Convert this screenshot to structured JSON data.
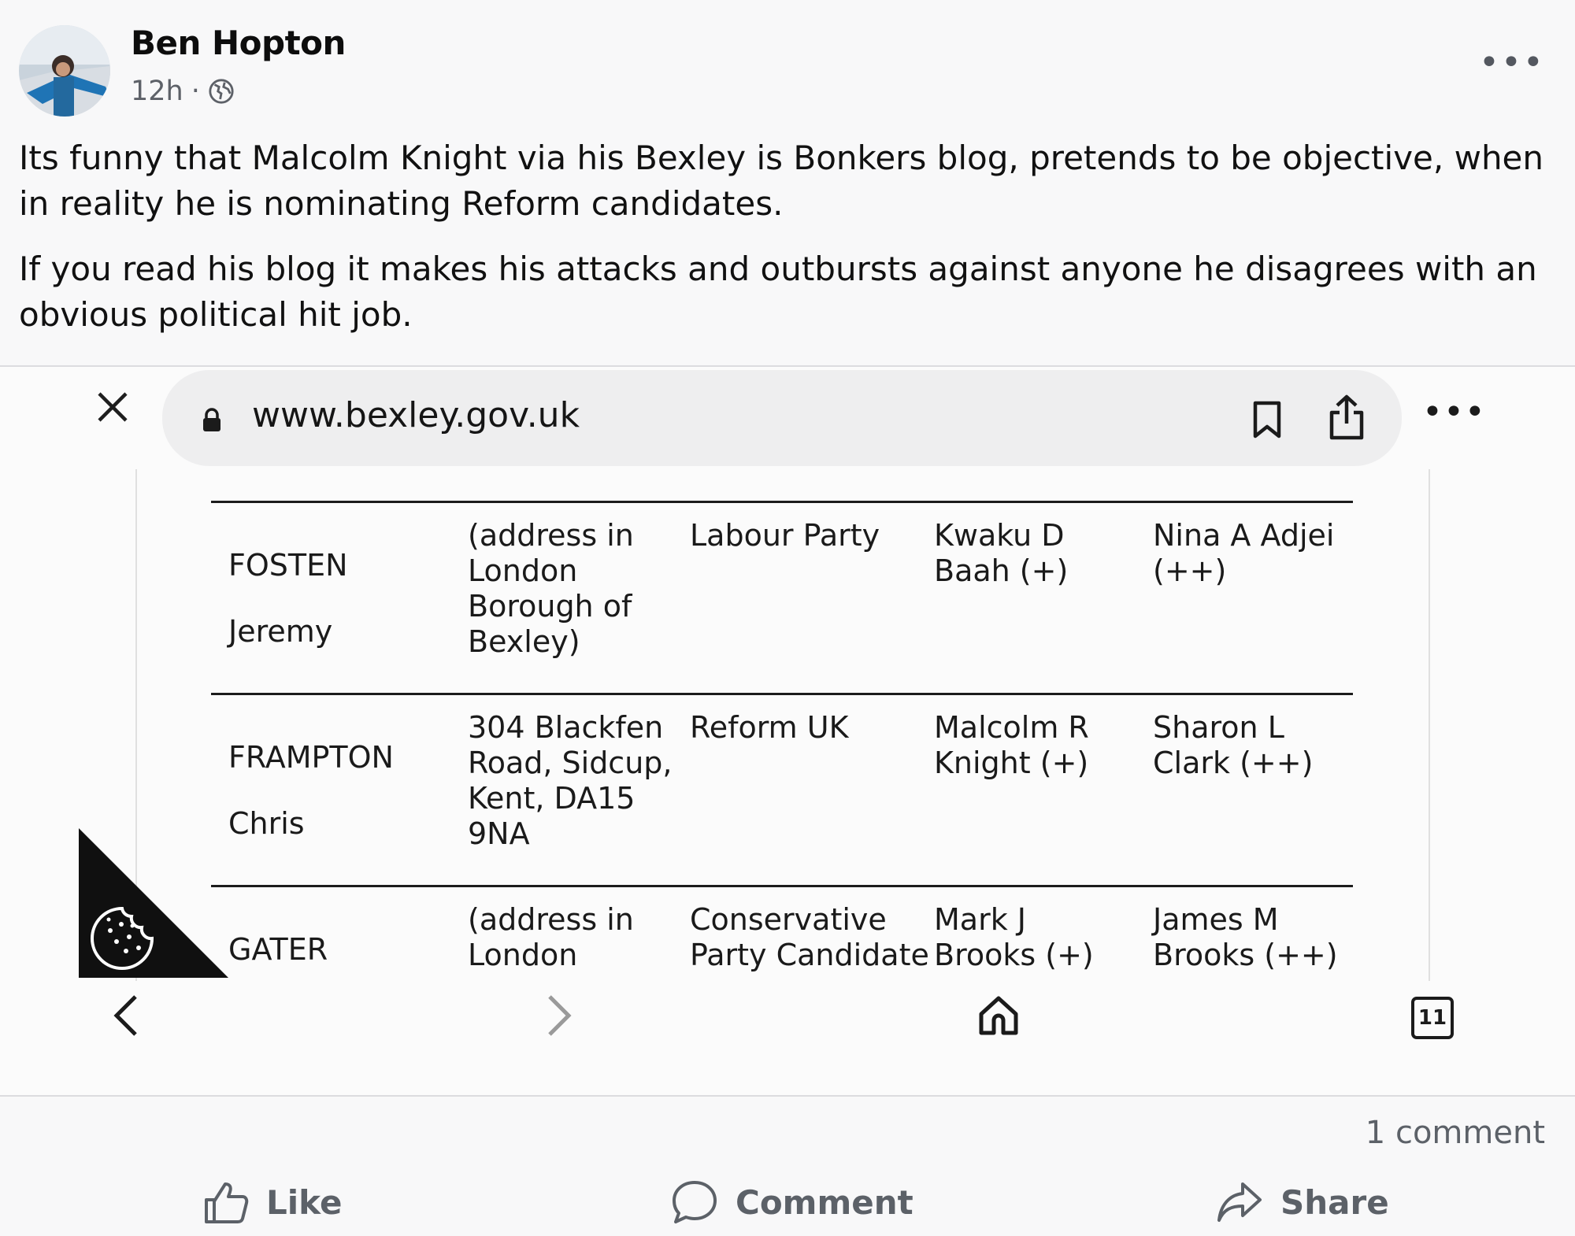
{
  "post": {
    "author": "Ben Hopton",
    "time": "12h",
    "separator": "·",
    "paragraphs": [
      "Its funny that Malcolm Knight via his Bexley is Bonkers blog, pretends to be objective, when in reality he is nominating Reform candidates.",
      "If you read his blog it makes his attacks and outbursts against anyone he disagrees with an obvious political hit job."
    ],
    "comment_count": "1 comment"
  },
  "browser": {
    "url": "www.bexley.gov.uk",
    "tab_count": "11",
    "icons": [
      "close-icon",
      "lock-icon",
      "bookmark-icon",
      "share-icon",
      "more-icon",
      "back-icon",
      "forward-icon",
      "home-icon",
      "tabs-icon",
      "cookie-icon"
    ]
  },
  "table": {
    "rows": [
      {
        "surname": "FOSTEN",
        "forename": "Jeremy",
        "address": [
          "(address in",
          "London",
          "Borough of",
          "Bexley)"
        ],
        "party": [
          "Labour Party"
        ],
        "proposer": [
          "Kwaku D",
          "Baah (+)"
        ],
        "seconder": [
          "Nina A Adjei",
          "(++)"
        ]
      },
      {
        "surname": "FRAMPTON",
        "forename": "Chris",
        "address": [
          "304 Blackfen",
          "Road, Sidcup,",
          "Kent, DA15",
          "9NA"
        ],
        "party": [
          "Reform UK"
        ],
        "proposer": [
          "Malcolm R",
          "Knight (+)"
        ],
        "seconder": [
          "Sharon L",
          "Clark (++)"
        ]
      },
      {
        "surname": "GATER",
        "forename": "",
        "address": [
          "(address in",
          "London"
        ],
        "party": [
          "Conservative",
          "Party Candidate"
        ],
        "proposer": [
          "Mark J",
          "Brooks (+)"
        ],
        "seconder": [
          "James M",
          "Brooks (++)"
        ]
      }
    ]
  },
  "actions": {
    "like": "Like",
    "comment": "Comment",
    "share": "Share"
  },
  "colors": {
    "background": "#f8f8f9",
    "text": "#111111",
    "muted": "#5c6168",
    "table_rule": "#1c1c1c"
  }
}
